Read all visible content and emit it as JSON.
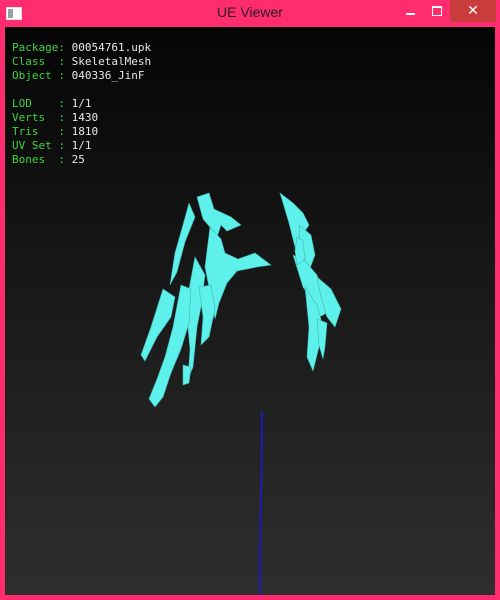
{
  "window": {
    "title": "UE Viewer",
    "border_color": "#ff2d6f",
    "icons": [
      "app-icon",
      "minimize-icon",
      "maximize-icon",
      "close-icon"
    ]
  },
  "info": {
    "package": {
      "label": "Package:",
      "value": "00054761.upk"
    },
    "class": {
      "label": "Class  :",
      "value": "SkeletalMesh"
    },
    "object": {
      "label": "Object :",
      "value": "040336_JinF"
    },
    "lod": {
      "label": "LOD    :",
      "value": "1/1"
    },
    "verts": {
      "label": "Verts  :",
      "value": "1430"
    },
    "tris": {
      "label": "Tris   :",
      "value": "1810"
    },
    "uv_set": {
      "label": "UV Set :",
      "value": "1/1"
    },
    "bones": {
      "label": "Bones  :",
      "value": "25"
    }
  },
  "colors": {
    "label": "#3fd33f",
    "value": "#e8e8e8",
    "mesh": "#5ef0ea",
    "axis": "#1a1ab4"
  }
}
